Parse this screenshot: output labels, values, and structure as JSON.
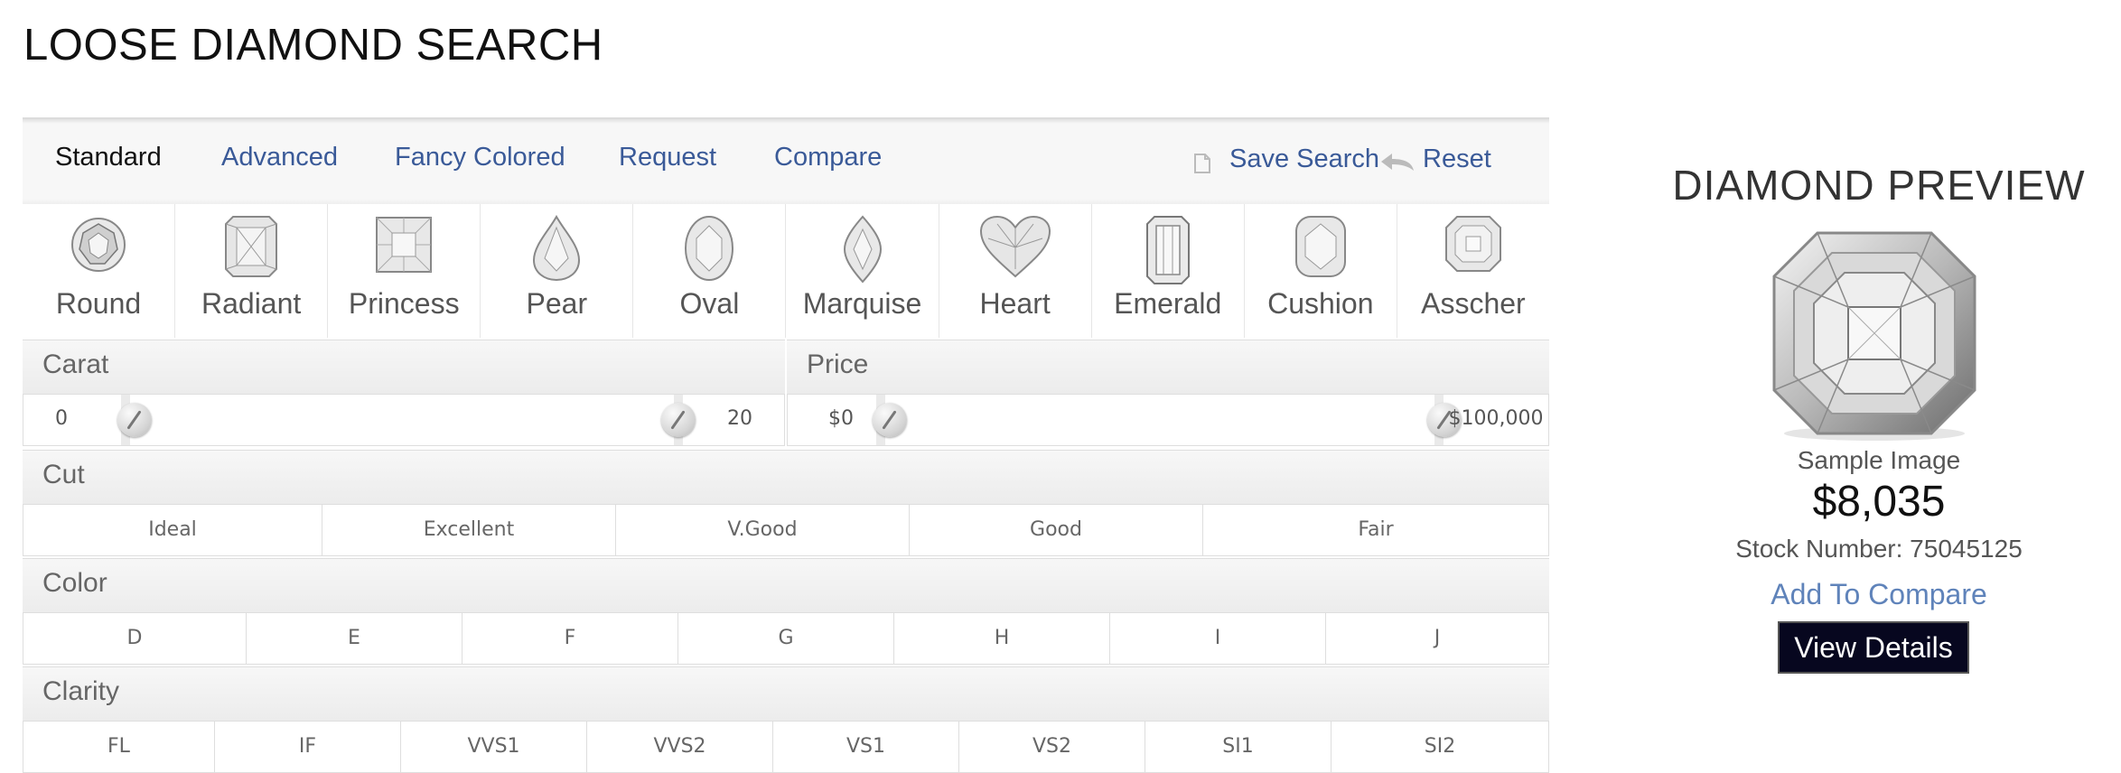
{
  "page": {
    "title": "LOOSE DIAMOND SEARCH"
  },
  "tabs": [
    {
      "label": "Standard",
      "active": true
    },
    {
      "label": "Advanced"
    },
    {
      "label": "Fancy Colored"
    },
    {
      "label": "Request"
    },
    {
      "label": "Compare"
    }
  ],
  "actions": {
    "save": "Save Search",
    "reset": "Reset"
  },
  "shapes": [
    "Round",
    "Radiant",
    "Princess",
    "Pear",
    "Oval",
    "Marquise",
    "Heart",
    "Emerald",
    "Cushion",
    "Asscher"
  ],
  "carat": {
    "label": "Carat",
    "min": "0",
    "max": "20"
  },
  "price": {
    "label": "Price",
    "min": "$0",
    "max": "$100,000"
  },
  "cut": {
    "label": "Cut",
    "options": [
      "Ideal",
      "Excellent",
      "V.Good",
      "Good",
      "Fair"
    ]
  },
  "color": {
    "label": "Color",
    "options": [
      "D",
      "E",
      "F",
      "G",
      "H",
      "I",
      "J"
    ]
  },
  "clarity": {
    "label": "Clarity",
    "options": [
      "FL",
      "IF",
      "VVS1",
      "VVS2",
      "VS1",
      "VS2",
      "SI1",
      "SI2"
    ]
  },
  "preview": {
    "title": "DIAMOND PREVIEW",
    "sample_label": "Sample Image",
    "price": "$8,035",
    "stock": "Stock Number: 75045125",
    "add_compare": "Add To Compare",
    "view_details": "View Details"
  },
  "colors": {
    "link": "#3a5a98",
    "button_bg": "#07071f",
    "compare_link": "#5f83ba"
  }
}
